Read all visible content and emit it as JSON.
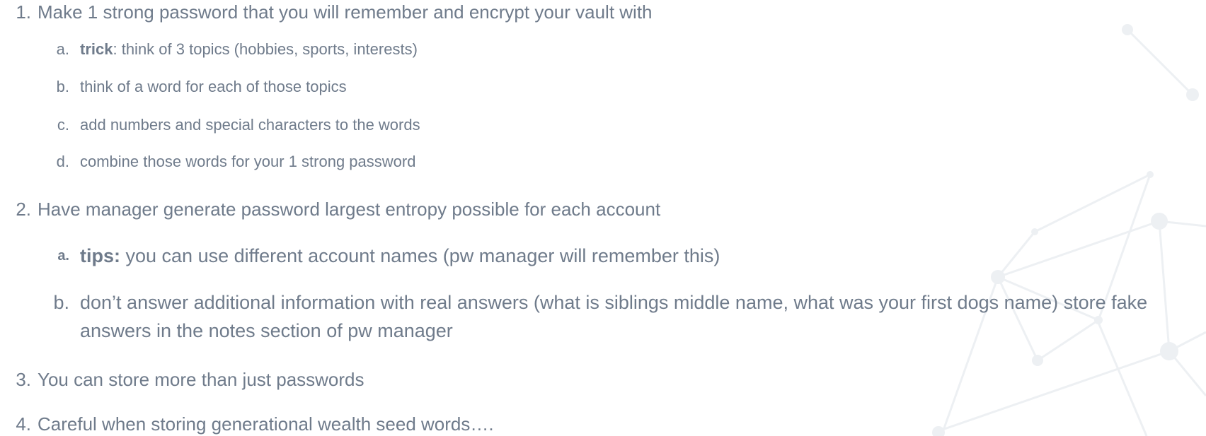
{
  "colors": {
    "text": "#6f7b8b",
    "background": "#ffffff",
    "network_lines": "#eceef1"
  },
  "list": [
    {
      "number": "1.",
      "text": "Make 1 strong password that you will remember and encrypt your vault with",
      "subitems": [
        {
          "letter": "a.",
          "bold": "trick",
          "text": ": think of 3 topics (hobbies, sports, interests)"
        },
        {
          "letter": "b.",
          "text": "think of a word for each of those topics"
        },
        {
          "letter": "c.",
          "text": "add numbers and special characters to the words"
        },
        {
          "letter": "d.",
          "text": "combine those words for your 1 strong password"
        }
      ]
    },
    {
      "number": "2.",
      "text": "Have manager generate password largest entropy possible for each account",
      "subitems": [
        {
          "letter": "a.",
          "bold": "tips:",
          "text": " you can use different account names (pw manager will remember this)"
        },
        {
          "letter": "b.",
          "text": "don’t answer additional information with real answers (what is siblings middle name, what was your first dogs name) store fake answers in the notes section of pw manager"
        }
      ]
    },
    {
      "number": "3.",
      "text": "You can store more than just passwords"
    },
    {
      "number": "4.",
      "text": "Careful when storing generational wealth seed words…."
    }
  ]
}
